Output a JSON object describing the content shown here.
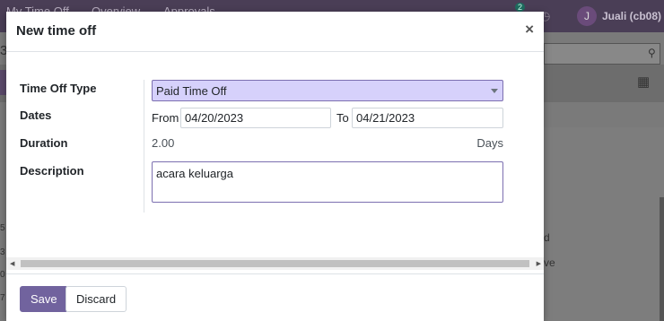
{
  "background": {
    "nav_items": [
      "My Time Off",
      "Overview",
      "Approvals"
    ],
    "chat_badge": "2",
    "user_initial": "J",
    "user_name": "Juali (cb08)",
    "left_fragment": "3",
    "edge_digits": [
      "5",
      "3",
      "0",
      "7"
    ],
    "right_fragments": [
      "d",
      "ve"
    ]
  },
  "modal": {
    "title": "New time off",
    "close_symbol": "×"
  },
  "form": {
    "time_off_type": {
      "label": "Time Off Type",
      "value": "Paid Time Off"
    },
    "dates": {
      "label": "Dates",
      "from_label": "From",
      "from_value": "04/20/2023",
      "to_label": "To",
      "to_value": "04/21/2023"
    },
    "duration": {
      "label": "Duration",
      "value": "2.00",
      "unit": "Days"
    },
    "description": {
      "label": "Description",
      "value": "acara keluarga"
    }
  },
  "footer": {
    "save_label": "Save",
    "discard_label": "Discard"
  },
  "colors": {
    "primary": "#71639e",
    "select_bg": "#d6d1fb",
    "nav_bg": "#4a3e56"
  }
}
